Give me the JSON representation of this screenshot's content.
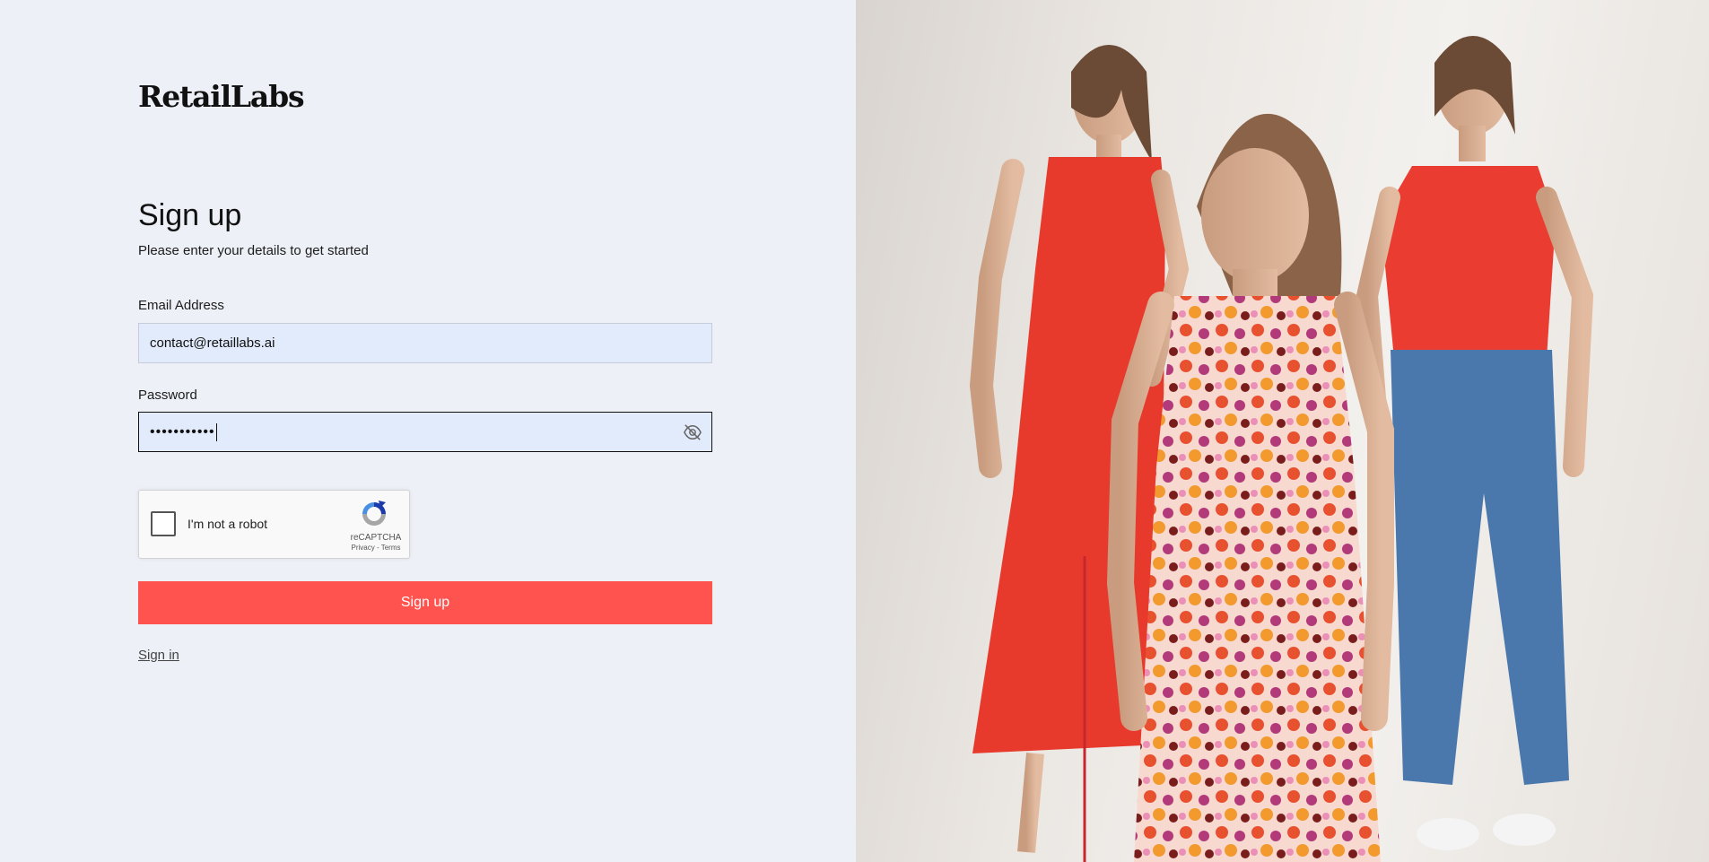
{
  "brand": {
    "logo_text": "RetailLabs"
  },
  "form": {
    "title": "Sign up",
    "subtitle": "Please enter your details to get started",
    "email": {
      "label": "Email Address",
      "value": "contact@retaillabs.ai"
    },
    "password": {
      "label": "Password",
      "masked_value": "•••••••••••",
      "toggle_icon": "eye-off-icon"
    },
    "captcha": {
      "label": "I'm not a robot",
      "brand": "reCAPTCHA",
      "links": "Privacy - Terms"
    },
    "submit_label": "Sign up",
    "signin_link": "Sign in"
  },
  "hero": {
    "description_icon": "models-photo"
  },
  "colors": {
    "accent": "#ff5350",
    "background": "#edf0f7",
    "input_bg": "#e2ebfb"
  }
}
